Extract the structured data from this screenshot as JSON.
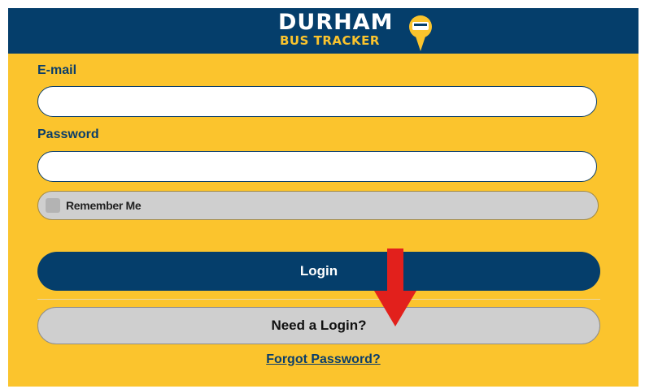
{
  "header": {
    "brand_line1": "DURHAM",
    "brand_line2": "BUS TRACKER",
    "logo_icon": "bus-pin-icon",
    "bg_color": "#053e6b"
  },
  "form": {
    "email_label": "E-mail",
    "email_value": "",
    "password_label": "Password",
    "password_value": "",
    "remember_label": "Remember Me",
    "remember_checked": false,
    "login_label": "Login",
    "need_login_label": "Need a Login?",
    "forgot_label": "Forgot Password?"
  },
  "colors": {
    "accent": "#fbc42d",
    "primary": "#053e6b",
    "secondary_button": "#cfcfcf",
    "annotation_arrow": "#e2201c"
  },
  "annotation": {
    "icon": "red-down-arrow-icon"
  }
}
